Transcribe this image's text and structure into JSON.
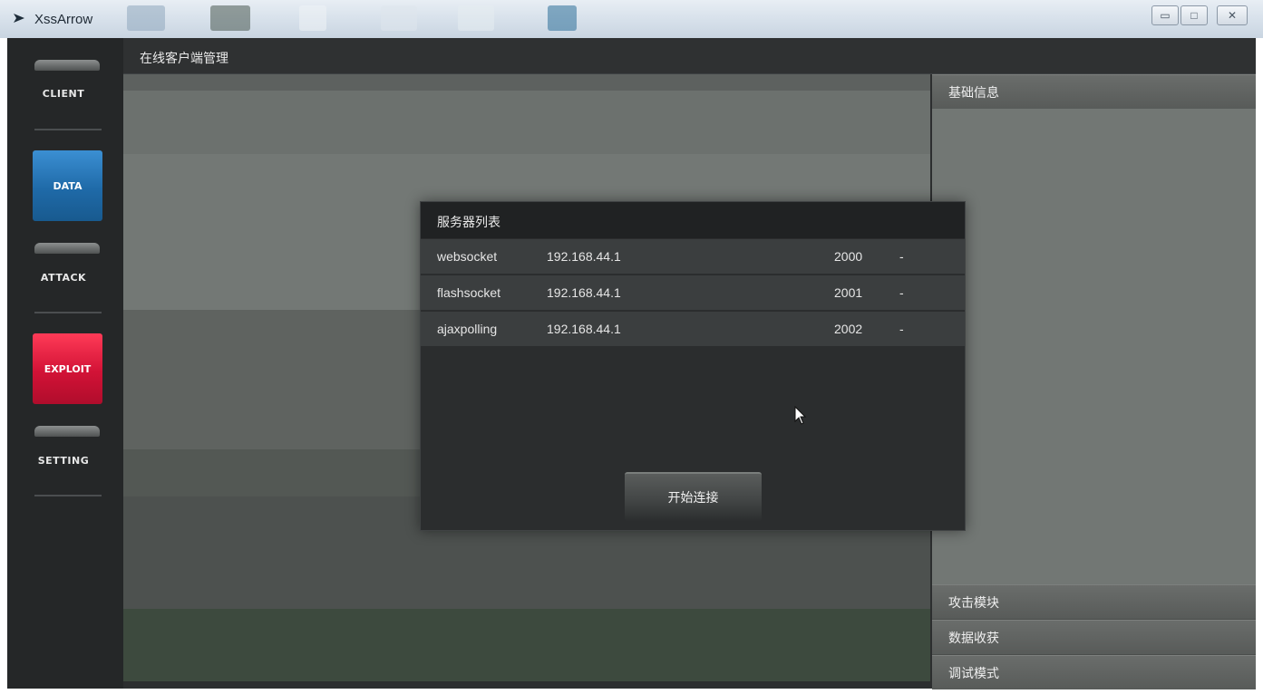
{
  "window": {
    "title": "XssArrow",
    "controls": {
      "minimize": "▭",
      "maximize": "□",
      "close": "✕"
    }
  },
  "sidebar": {
    "items": [
      {
        "label": "CLIENT",
        "accent": ""
      },
      {
        "label": "DATA",
        "accent": "#1f6aa8"
      },
      {
        "label": "ATTACK",
        "accent": ""
      },
      {
        "label": "EXPLOIT",
        "accent": "#d21236"
      },
      {
        "label": "SETTING",
        "accent": ""
      }
    ]
  },
  "header": {
    "title": "在线客户端管理"
  },
  "right_panel": {
    "sections": [
      {
        "label": "基础信息"
      },
      {
        "label": "攻击模块"
      },
      {
        "label": "数据收获"
      },
      {
        "label": "调试模式"
      }
    ]
  },
  "dialog": {
    "title": "服务器列表",
    "servers": [
      {
        "protocol": "websocket",
        "ip": "192.168.44.1",
        "port": "2000",
        "extra": "-"
      },
      {
        "protocol": "flashsocket",
        "ip": "192.168.44.1",
        "port": "2001",
        "extra": "-"
      },
      {
        "protocol": "ajaxpolling",
        "ip": "192.168.44.1",
        "port": "2002",
        "extra": "-"
      }
    ],
    "connect_label": "开始连接"
  },
  "icons": {
    "app_logo": "arrow-logo-icon",
    "cursor": "mouse-cursor-icon"
  }
}
